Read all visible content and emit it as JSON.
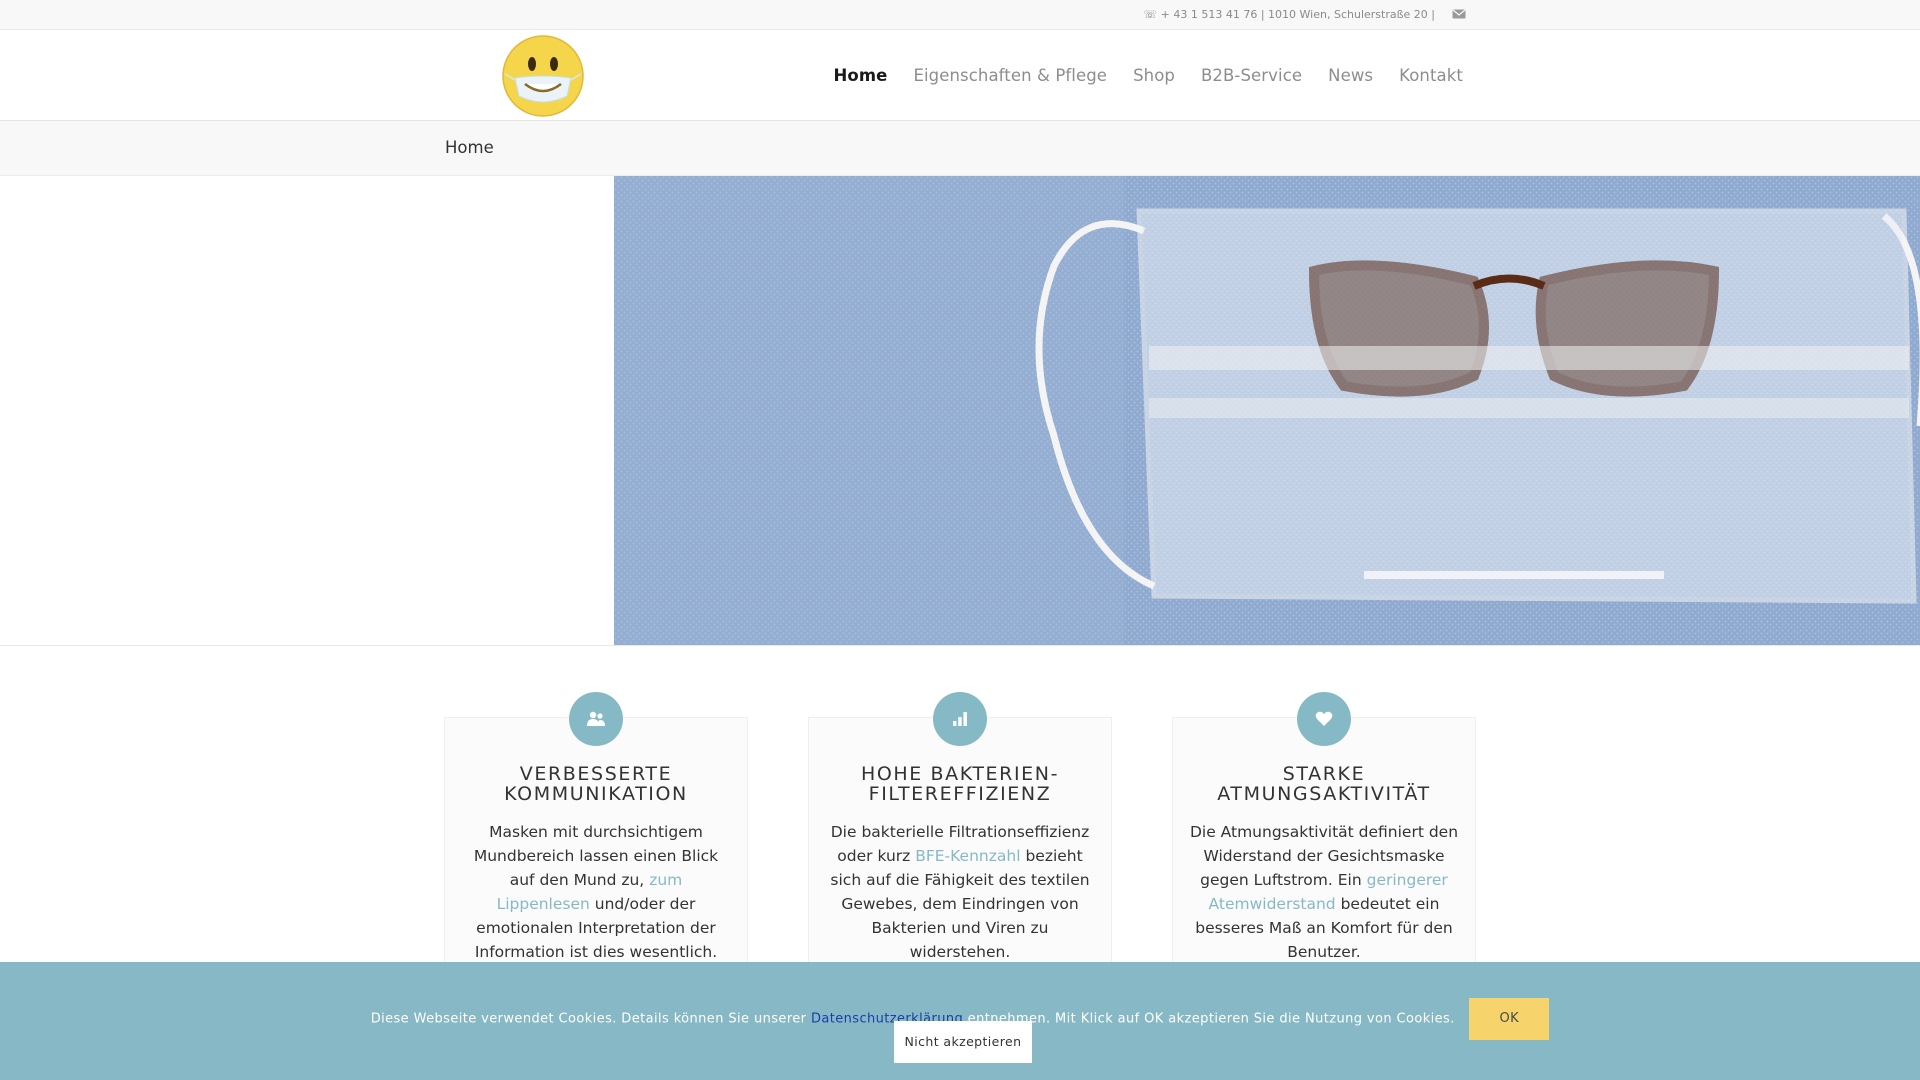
{
  "topbar": {
    "info": "☏ + 43 1 513 41 76 | 1010 Wien, Schulerstraße 20 |",
    "mail_icon": "envelope-icon"
  },
  "logo": {
    "icon": "smiley-face-with-mask-logo",
    "color": "#f5d64a"
  },
  "nav": {
    "items": [
      {
        "label": "Home",
        "active": true
      },
      {
        "label": "Eigenschaften & Pflege"
      },
      {
        "label": "Shop"
      },
      {
        "label": "B2B-Service"
      },
      {
        "label": "News"
      },
      {
        "label": "Kontakt"
      }
    ]
  },
  "page_title": "Home",
  "hero": {
    "image": "transparent face mask with glasses on blue fabric"
  },
  "features": [
    {
      "icon": "users-icon",
      "title_line1": "VERBESSERTE",
      "title_line2": "KOMMUNIKATION",
      "text_before": "Masken mit durchsichtigem Mundbereich lassen einen Blick auf den Mund zu,",
      "link": "zum Lippenlesen",
      "text_after": "und/oder der emotionalen Interpretation der Information ist dies wesentlich."
    },
    {
      "icon": "bar-chart-icon",
      "title_line1": "HOHE BAKTERIEN-",
      "title_line2": "FILTEREFFIZIENZ",
      "text_before": "Die bakterielle Filtrationseffizienz oder kurz",
      "link": "BFE-Kennzahl",
      "text_after": "bezieht sich auf die Fähigkeit des textilen Gewebes, dem Eindringen von Bakterien und Viren zu widerstehen."
    },
    {
      "icon": "heart-icon",
      "title_line1": "STARKE",
      "title_line2": "ATMUNGSAKTIVITÄT",
      "text_before": "Die Atmungsaktivität definiert den Widerstand der Gesichtsmaske gegen Luftstrom. Ein",
      "link": "geringerer Atemwiderstand",
      "text_after": "bedeutet ein besseres Maß an Komfort für den Benutzer."
    }
  ],
  "cookie": {
    "text_before": "Diese Webseite verwendet Cookies. Details können Sie unserer",
    "policy_link": "Datenschutzerklärung",
    "text_after": "entnehmen. Mit Klick auf OK akzeptieren Sie die Nutzung von Cookies.",
    "ok_label": "OK",
    "decline_label": "Nicht akzeptieren"
  },
  "colors": {
    "accent": "#86b9c6",
    "cookie_bg": "#87b8c6",
    "ok_button": "#f7d36b",
    "link_dark": "#1b3ea8"
  }
}
